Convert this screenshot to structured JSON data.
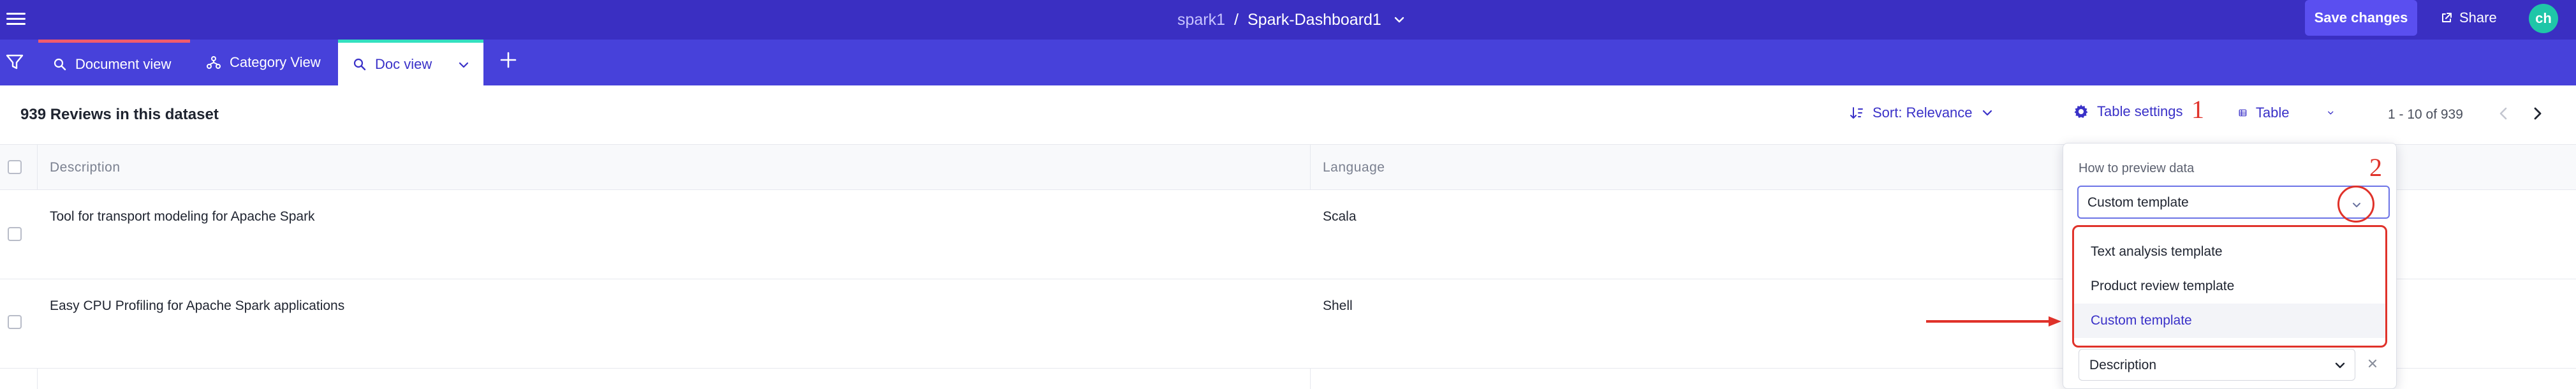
{
  "app": {
    "breadcrumb": {
      "project": "spark1",
      "separator": "/",
      "dashboard": "Spark-Dashboard1"
    },
    "save_label": "Save changes",
    "share_label": "Share",
    "avatar_initials": "ch"
  },
  "tabs": [
    {
      "label": "Document view",
      "icon": "search-icon"
    },
    {
      "label": "Category View",
      "icon": "hierarchy-icon"
    },
    {
      "label": "Doc view",
      "icon": "search-icon",
      "active": true
    }
  ],
  "toolbar": {
    "reviews_count": "939 Reviews in this dataset",
    "sort_label": "Sort: Relevance",
    "table_settings_label": "Table settings",
    "view_label": "Table",
    "pagination": "1 - 10 of 939"
  },
  "annotations": {
    "step1": "1",
    "step2": "2"
  },
  "table": {
    "columns": [
      "Description",
      "Language"
    ],
    "rows": [
      {
        "description": "Tool for transport modeling for Apache Spark",
        "language": "Scala"
      },
      {
        "description": "Easy CPU Profiling for Apache Spark applications",
        "language": "Shell"
      }
    ]
  },
  "preview_popover": {
    "label": "How to preview data",
    "selected_template": "Custom template",
    "options": [
      "Text analysis template",
      "Product review template",
      "Custom template"
    ],
    "field_value": "Description"
  },
  "colors": {
    "topbar": "#3a2fc2",
    "tabbar": "#4741da",
    "accent": "#3a31c8",
    "annotation_red": "#e0322a",
    "avatar": "#1fc6a8"
  }
}
